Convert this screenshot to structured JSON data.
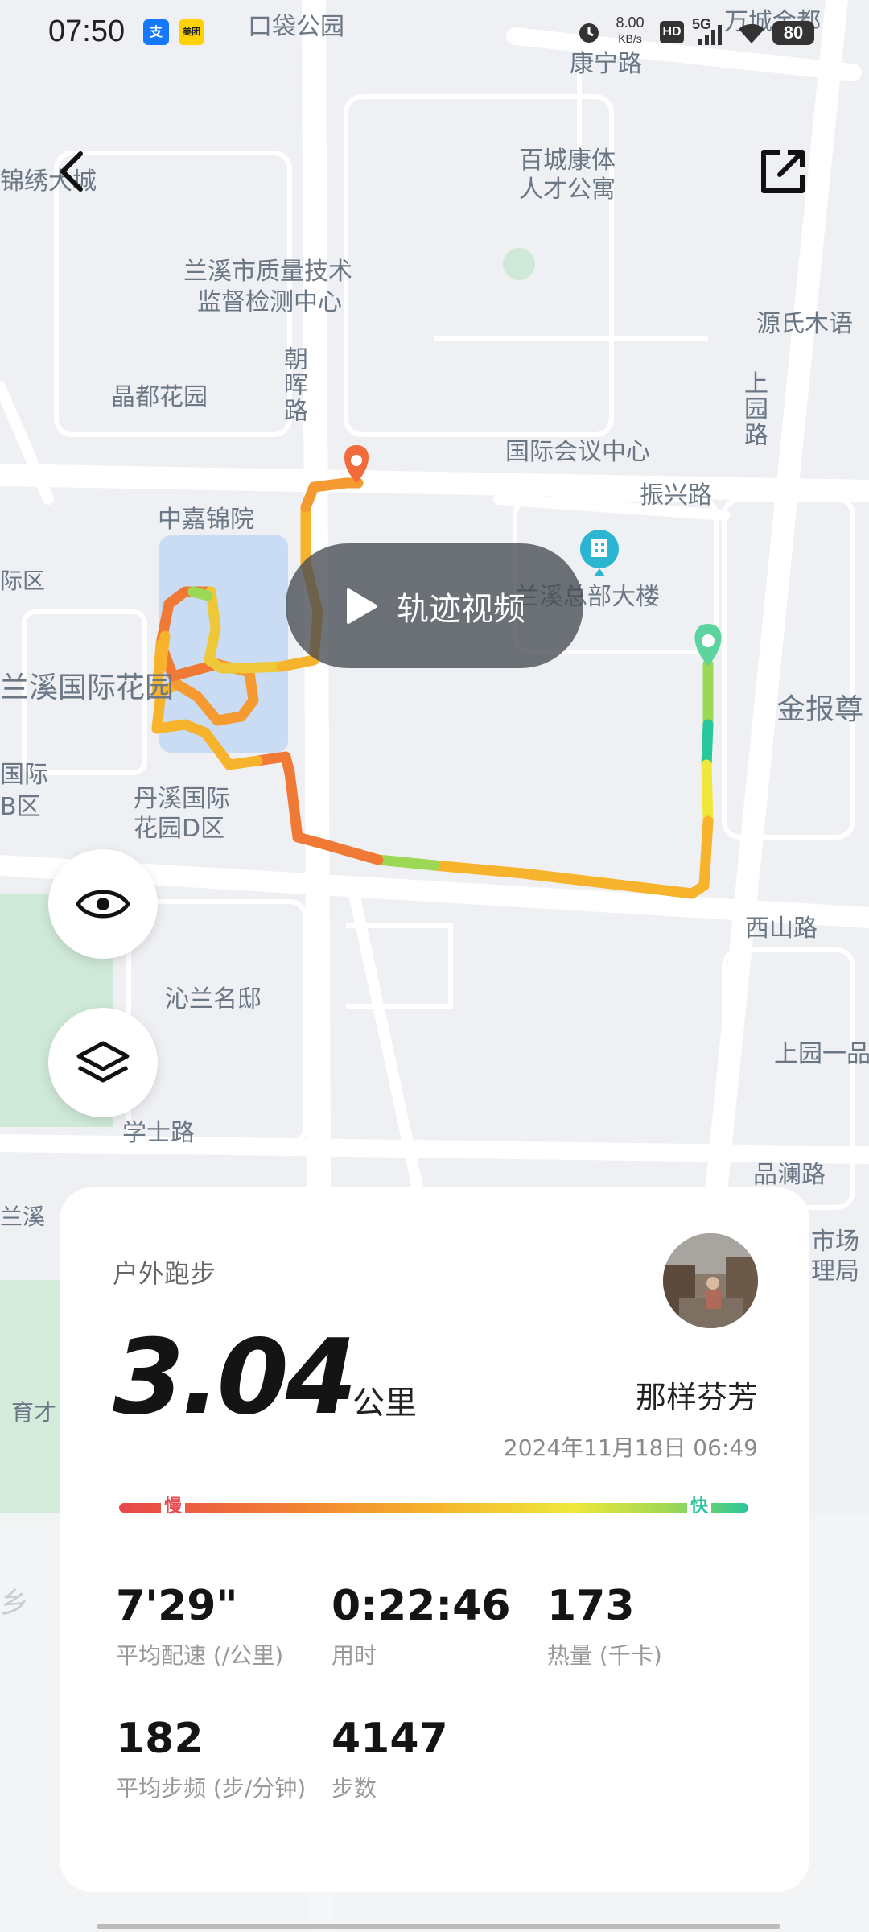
{
  "status_bar": {
    "time": "07:50",
    "app1": "支",
    "app2": "美团",
    "speed_value": "8.00",
    "speed_unit": "KB/s",
    "hd": "HD",
    "network": "5G",
    "battery": "80"
  },
  "map": {
    "labels": {
      "koudai_park": "口袋公园",
      "kangning_road": "康宁路",
      "wancheng": "万城金都",
      "jinxiu": "锦绣大城",
      "baicheng_line1": "百城康体",
      "baicheng_line2": "人才公寓",
      "zhiliang_line1": "兰溪市质量技术",
      "zhiliang_line2": "监督检测中心",
      "yuanshi": "源氏木语",
      "chaohui_road": "朝晖路",
      "shangyuan_road": "上园路",
      "jingdu": "晶都花园",
      "guoji_huiyi": "国际会议中心",
      "zhenxing_road": "振兴路",
      "zhongjia": "中嘉锦院",
      "zongbu": "兰溪总部大楼",
      "guoji_huayuan": "兰溪国际花园",
      "jinbao": "金报尊",
      "danxi_line1": "丹溪国际",
      "danxi_line2": "花园D区",
      "xishan_road": "西山路",
      "qinlan": "沁兰名邸",
      "shangyuan_yi": "上园一品",
      "xueshi_road": "学士路",
      "pinlan_road": "品澜路",
      "shichang_line1": "市场",
      "shichang_line2": "理局",
      "left_lanxi": "兰溪",
      "left_yu": "育才",
      "ji_qu": "际区",
      "guoji_b": "国际",
      "b_qu": "B区",
      "xiang": "乡"
    }
  },
  "controls": {
    "back_icon": "chevron-left",
    "share_icon": "external-link",
    "play_label": "轨迹视频",
    "eye_icon": "eye",
    "layers_icon": "layers"
  },
  "summary": {
    "activity_type": "户外跑步",
    "distance": "3.04",
    "distance_unit": "公里",
    "user_name": "那样芬芳",
    "datetime": "2024年11月18日 06:49",
    "pace_slow": "慢",
    "pace_fast": "快",
    "stats": [
      {
        "value": "7'29\"",
        "label": "平均配速 (/公里)"
      },
      {
        "value": "0:22:46",
        "label": "用时"
      },
      {
        "value": "173",
        "label": "热量 (千卡)"
      },
      {
        "value": "182",
        "label": "平均步频 (步/分钟)"
      },
      {
        "value": "4147",
        "label": "步数"
      }
    ]
  },
  "colors": {
    "slow": "#e8474b",
    "fast": "#27c69b",
    "end_marker": "#f26b3a",
    "start_marker": "#5dd3a0",
    "building_marker": "#2bb5d0"
  }
}
